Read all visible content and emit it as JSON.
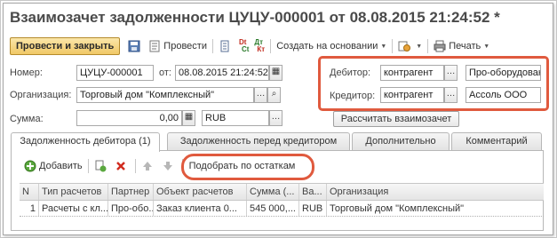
{
  "window": {
    "title": "Взаимозачет задолженности ЦУЦУ-000001 от 08.08.2015 21:24:52 *"
  },
  "toolbar": {
    "post_close": "Провести и закрыть",
    "post": "Провести",
    "create_based_on": "Создать на основании",
    "print": "Печать",
    "dt_label": "Dt",
    "ct_label": "Ct",
    "dt_label2": "Дт",
    "ct_label2": "Кт"
  },
  "header": {
    "number_label": "Номер:",
    "number_value": "ЦУЦУ-000001",
    "from_label": "от:",
    "date_value": "08.08.2015 21:24:52",
    "org_label": "Организация:",
    "org_value": "Торговый дом \"Комплексный\"",
    "sum_label": "Сумма:",
    "sum_value": "0,00",
    "currency_value": "RUB",
    "debtor_label": "Дебитор:",
    "debtor_type": "контрагент",
    "debtor_value": "Про-оборудование",
    "creditor_label": "Кредитор:",
    "creditor_type": "контрагент",
    "creditor_value": "Ассоль ООО",
    "calc_button": "Рассчитать взаимозачет"
  },
  "tabs": [
    {
      "label": "Задолженность дебитора (1)"
    },
    {
      "label": "Задолженность перед кредитором"
    },
    {
      "label": "Дополнительно"
    },
    {
      "label": "Комментарий"
    }
  ],
  "list_toolbar": {
    "add": "Добавить",
    "pick_by_balance": "Подобрать по остаткам"
  },
  "grid": {
    "columns": [
      "N",
      "Тип расчетов",
      "Партнер",
      "Объект расчетов",
      "Сумма (...",
      "Ва...",
      "Организация"
    ],
    "rows": [
      [
        "1",
        "Расчеты с кл...",
        "Про-обо...",
        "Заказ клиента 0...",
        "545 000,...",
        "RUB",
        "Торговый дом \"Комплексный\""
      ]
    ]
  },
  "colors": {
    "highlight": "#e05a3e",
    "primary_button": "#f0c866"
  }
}
